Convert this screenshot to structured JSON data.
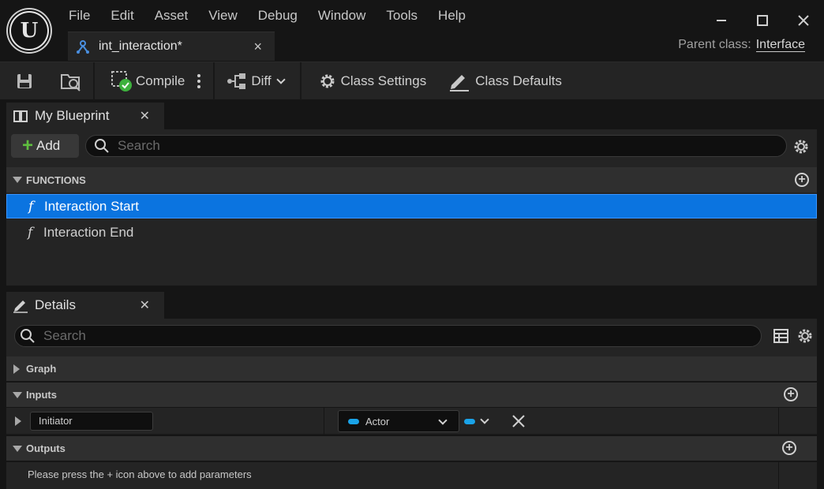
{
  "menu": [
    "File",
    "Edit",
    "Asset",
    "View",
    "Debug",
    "Window",
    "Tools",
    "Help"
  ],
  "document_tab": {
    "label": "int_interaction*",
    "close": "×"
  },
  "parent_class": {
    "label": "Parent class:",
    "value": "Interface"
  },
  "toolbar": {
    "compile_label": "Compile",
    "diff_label": "Diff",
    "class_settings_label": "Class Settings",
    "class_defaults_label": "Class Defaults"
  },
  "my_blueprint": {
    "tab_label": "My Blueprint",
    "add_label": "Add",
    "search_placeholder": "Search",
    "functions_header": "FUNCTIONS",
    "functions": [
      {
        "label": "Interaction Start",
        "selected": true
      },
      {
        "label": "Interaction End",
        "selected": false
      }
    ]
  },
  "details": {
    "tab_label": "Details",
    "search_placeholder": "Search",
    "graph_header": "Graph",
    "inputs_header": "Inputs",
    "input_param": {
      "name": "Initiator",
      "type": "Actor"
    },
    "outputs_header": "Outputs",
    "outputs_hint": "Please press the + icon above to add parameters"
  },
  "colors": {
    "selected_row": "#0b74e0",
    "actor_pin": "#1aa3e8",
    "add_plus": "#5fbf3f",
    "compile_ok": "#3db13d"
  }
}
